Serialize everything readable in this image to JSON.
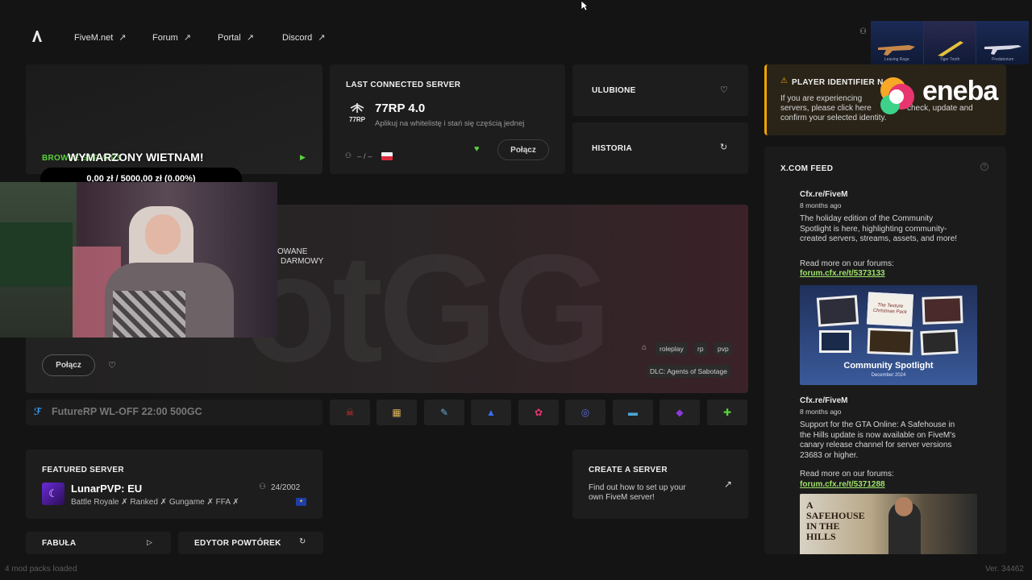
{
  "nav": {
    "logo_icon": "fivem-logo-icon",
    "links": [
      "FiveM.net",
      "Forum",
      "Portal",
      "Discord"
    ]
  },
  "browse": {
    "label": "BROWSE SERVERS"
  },
  "overlay": {
    "title": "WYMARZONY WIETNAM!",
    "progress": "0,00 zł / 5000,00 zł (0.00%)"
  },
  "last_server": {
    "heading": "LAST CONNECTED SERVER",
    "name": "77RP 4.0",
    "description": "Aplikuj na whitelistę i stań się częścią jednej",
    "players": "– / –",
    "connect": "Połącz"
  },
  "quick": {
    "favorites": "ULUBIONE",
    "history": "HISTORIA"
  },
  "player_notice": {
    "heading": "PLAYER IDENTIFIER N",
    "body_line1": "If you are experiencing",
    "body_line2": "servers, please click here",
    "body_line2b": "check, update and",
    "body_line3": "confirm your selected identity."
  },
  "ad": {
    "brand": "eneba"
  },
  "weapons": [
    "Leaving Rage",
    "Tiger Tooth",
    "Predatorium"
  ],
  "banner": {
    "text1": "OWANE",
    "text2": "DARMOWY",
    "watermark": "otGG",
    "connect": "Połącz",
    "tags": [
      "roleplay",
      "rp",
      "pvp"
    ],
    "dlc": "DLC: Agents of Sabotage"
  },
  "ticker": {
    "text": "FutureRP WL-OFF 22:00 500GC"
  },
  "featured": {
    "heading": "FEATURED SERVER",
    "name": "LunarPVP: EU",
    "players": "24/2002",
    "tags": "Battle Royale ✗ Ranked ✗ Gungame ✗ FFA ✗"
  },
  "create": {
    "heading": "CREATE A SERVER",
    "line1": "Find out how to set up your",
    "line2": "own FiveM server!"
  },
  "bottom": {
    "story": "FABUŁA",
    "editor": "EDYTOR POWTÓREK"
  },
  "feed": {
    "heading": "X.COM FEED",
    "posts": [
      {
        "author": "Cfx.re/FiveM",
        "time": "8 months ago",
        "l1": "The holiday edition of the Community",
        "l2": "Spotlight is here, highlighting community-",
        "l3": "created servers, streams, assets, and more!",
        "more": "Read more on our forums:",
        "link": "forum.cfx.re/t/5373133",
        "image_title": "Community Spotlight",
        "image_sub": "December 2024",
        "image_card": "The Texture Christmas Pack"
      },
      {
        "author": "Cfx.re/FiveM",
        "time": "8 months ago",
        "l1": "Support for the GTA Online: A Safehouse in",
        "l2": "the Hills update is now available on FiveM's",
        "l3": "canary release channel for server versions",
        "l4": "23683 or higher.",
        "more": "Read more on our forums:",
        "link": "forum.cfx.re/t/5371288",
        "image_title": "A SAFEHOUSE IN THE HILLS"
      }
    ]
  },
  "footer": {
    "status": "4 mod packs loaded",
    "version": "Ver. 34462"
  },
  "colors": {
    "accent_green": "#5ad13b",
    "warning": "#f0a500",
    "link": "#9fe36a"
  }
}
